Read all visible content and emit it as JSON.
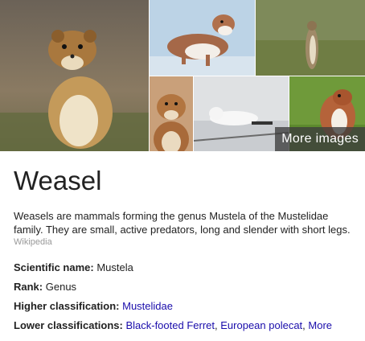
{
  "gallery": {
    "more_images_label": "More images",
    "images": [
      {
        "name": "weasel-photo-main"
      },
      {
        "name": "weasel-photo-white"
      },
      {
        "name": "weasel-photo-standing"
      },
      {
        "name": "weasel-photo-portrait"
      },
      {
        "name": "weasel-photo-snow"
      },
      {
        "name": "weasel-photo-grass"
      }
    ]
  },
  "entity": {
    "title": "Weasel",
    "description": "Weasels are mammals forming the genus Mustela of the Mustelidae family. They are small, active predators, long and slender with short legs.",
    "source": "Wikipedia"
  },
  "facts": {
    "scientific_name": {
      "label": "Scientific name:",
      "value": "Mustela"
    },
    "rank": {
      "label": "Rank:",
      "value": "Genus"
    },
    "higher_classification": {
      "label": "Higher classification:",
      "value": "Mustelidae"
    },
    "lower_classifications": {
      "label": "Lower classifications:",
      "links": [
        "Black-footed Ferret",
        "European polecat",
        "More"
      ],
      "separator": ","
    }
  },
  "colors": {
    "link": "#1a0dab",
    "source": "#999999",
    "overlay": "#3c3c3c"
  }
}
